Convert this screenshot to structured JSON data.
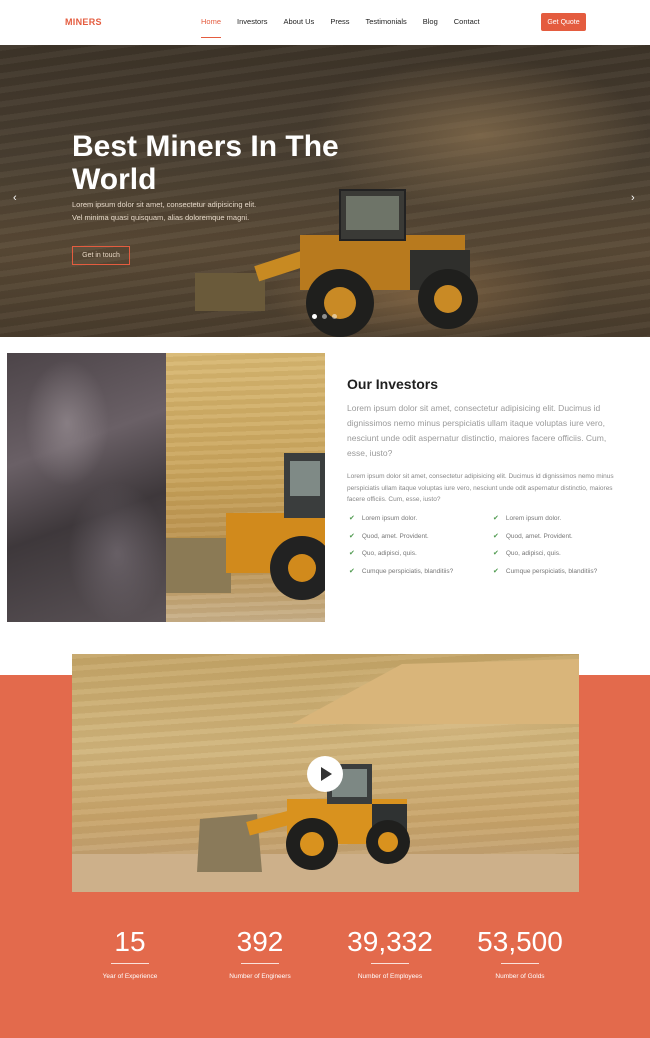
{
  "colors": {
    "accent": "#e45c3f",
    "orange_bg": "#e36a4c"
  },
  "nav": {
    "brand": "MINERS",
    "items": [
      {
        "label": "Home",
        "active": true
      },
      {
        "label": "Investors",
        "active": false
      },
      {
        "label": "About Us",
        "active": false
      },
      {
        "label": "Press",
        "active": false
      },
      {
        "label": "Testimonials",
        "active": false
      },
      {
        "label": "Blog",
        "active": false
      },
      {
        "label": "Contact",
        "active": false
      }
    ],
    "cta": "Get Quote"
  },
  "hero": {
    "title": "Best Miners In The World",
    "text": "Lorem ipsum dolor sit amet, consectetur adipisicing elit. Vel minima quasi quisquam, alias doloremque magni.",
    "button": "Get in touch",
    "prev_icon": "chevron-left-icon",
    "next_icon": "chevron-right-icon",
    "slide_count": 3,
    "active_slide": 1
  },
  "investors": {
    "title": "Our Investors",
    "lead": "Lorem ipsum dolor sit amet, consectetur adipisicing elit. Ducimus id dignissimos nemo minus perspiciatis ullam itaque voluptas iure vero, nesciunt unde odit aspernatur distinctio, maiores facere officiis. Cum, esse, iusto?",
    "body": "Lorem ipsum dolor sit amet, consectetur adipisicing elit. Ducimus id dignissimos nemo minus perspiciatis ullam itaque voluptas iure vero, nesciunt unde odit aspernatur distinctio, maiores facere officiis. Cum, esse, iusto?",
    "checklist_left": [
      "Lorem ipsum dolor.",
      "Quod, amet. Provident.",
      "Quo, adipisci, quis.",
      "Cumque perspiciatis, blanditiis?"
    ],
    "checklist_right": [
      "Lorem ipsum dolor.",
      "Quod, amet. Provident.",
      "Quo, adipisci, quis.",
      "Cumque perspiciatis, blanditiis?"
    ]
  },
  "video": {
    "play_icon": "play-icon"
  },
  "stats": [
    {
      "number": "15",
      "label": "Year of Experience"
    },
    {
      "number": "392",
      "label": "Number of Engineers"
    },
    {
      "number": "39,332",
      "label": "Number of Employees"
    },
    {
      "number": "53,500",
      "label": "Number of Golds"
    }
  ]
}
